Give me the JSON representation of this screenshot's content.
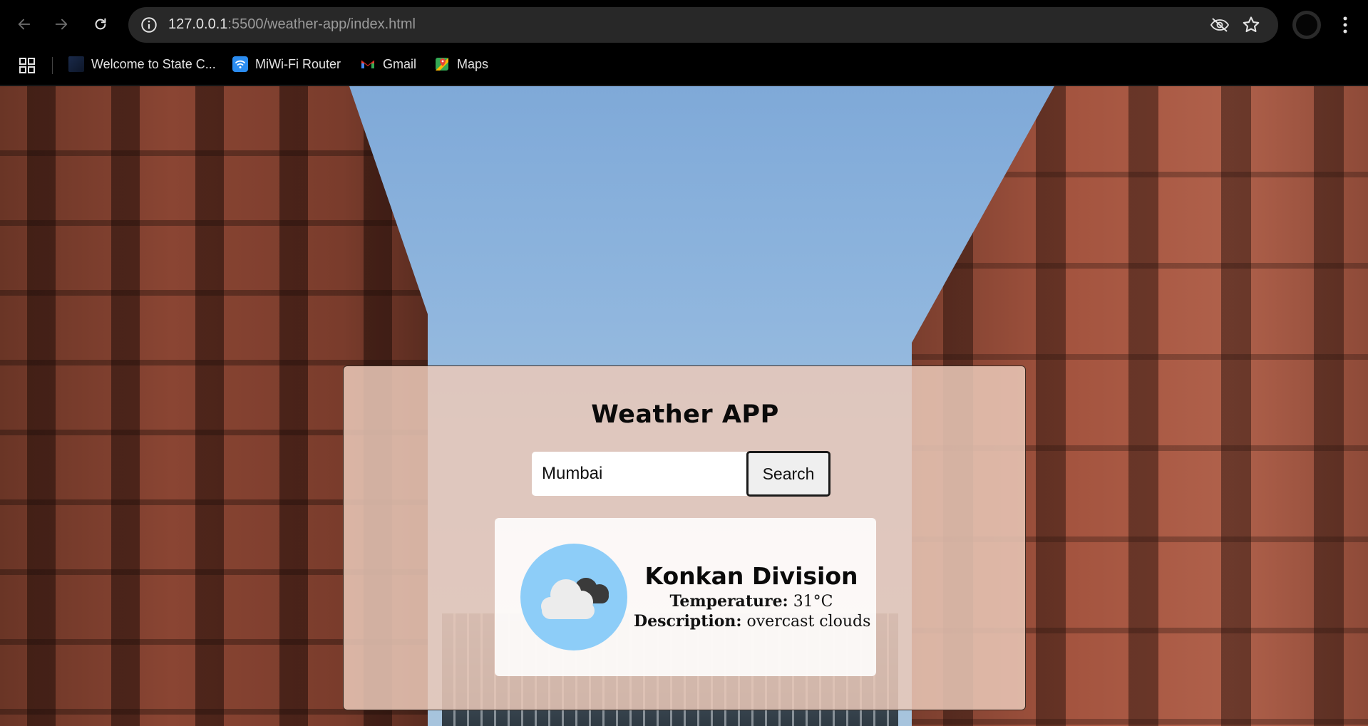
{
  "browser": {
    "url_host": "127.0.0.1",
    "url_path": ":5500/weather-app/index.html",
    "bookmarks": [
      {
        "label": "Welcome to State C..."
      },
      {
        "label": "MiWi-Fi Router"
      },
      {
        "label": "Gmail"
      },
      {
        "label": "Maps"
      }
    ]
  },
  "app": {
    "title": "Weather APP",
    "search": {
      "value": "Mumbai",
      "button_label": "Search"
    },
    "result": {
      "city": "Konkan Division",
      "temperature_label": "Temperature:",
      "temperature_value": "31°C",
      "description_label": "Description:",
      "description_value": "overcast clouds",
      "icon": "cloud-icon"
    }
  },
  "colors": {
    "card_overlay": "#eac8b8",
    "icon_circle": "#8dcdf8"
  }
}
